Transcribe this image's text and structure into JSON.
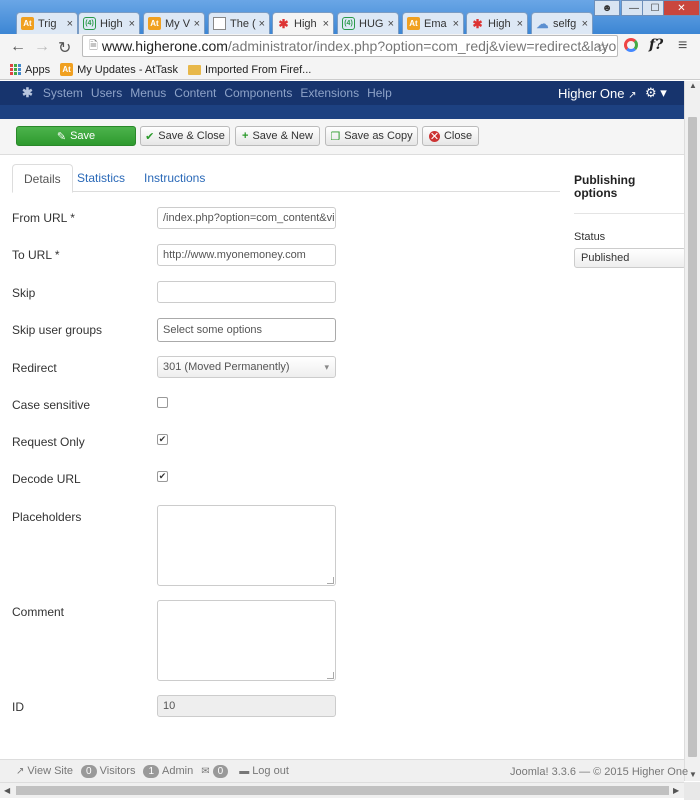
{
  "browser": {
    "tabs": [
      {
        "icon": "at-icon",
        "label": "Trig"
      },
      {
        "icon": "count-icon",
        "label": "High"
      },
      {
        "icon": "at-icon",
        "label": "My V"
      },
      {
        "icon": "doc-icon",
        "label": "The ("
      },
      {
        "icon": "joomla-icon",
        "label": "High"
      },
      {
        "icon": "count-icon",
        "label": "HUG"
      },
      {
        "icon": "at-icon",
        "label": "Ema"
      },
      {
        "icon": "joomla-icon",
        "label": "High"
      },
      {
        "icon": "cloud-icon",
        "label": "selfg"
      }
    ],
    "fav_at": "At",
    "fav_count": "(4)",
    "close_glyph": "×",
    "url_host": "www.higherone.com",
    "url_path": "/administrator/index.php?option=com_redj&view=redirect&layout=",
    "ext_f": "f?",
    "bookmarks": [
      {
        "icon": "apps-icon",
        "label": "Apps"
      },
      {
        "icon": "at-icon",
        "label": "My Updates - AtTask"
      },
      {
        "icon": "folder-icon",
        "label": "Imported From Firef..."
      }
    ]
  },
  "admin_nav": {
    "items": [
      "System",
      "Users",
      "Menus",
      "Content",
      "Components",
      "Extensions",
      "Help"
    ],
    "site_name": "Higher One"
  },
  "toolbar": {
    "save": "Save",
    "save_close": "Save & Close",
    "save_new": "Save & New",
    "save_copy": "Save as Copy",
    "close": "Close"
  },
  "form_tabs": [
    "Details",
    "Statistics",
    "Instructions"
  ],
  "form": {
    "from_url_label": "From URL *",
    "from_url_value": "/index.php?option=com_content&vie",
    "to_url_label": "To URL *",
    "to_url_value": "http://www.myonemoney.com",
    "skip_label": "Skip",
    "skip_value": "",
    "skip_groups_label": "Skip user groups",
    "skip_groups_placeholder": "Select some options",
    "redirect_label": "Redirect",
    "redirect_value": "301 (Moved Permanently)",
    "case_sensitive_label": "Case sensitive",
    "case_sensitive_checked": false,
    "request_only_label": "Request Only",
    "request_only_checked": true,
    "decode_url_label": "Decode URL",
    "decode_url_checked": true,
    "placeholders_label": "Placeholders",
    "comment_label": "Comment",
    "id_label": "ID",
    "id_value": "10"
  },
  "sidebar": {
    "title": "Publishing options",
    "status_label": "Status",
    "status_value": "Published"
  },
  "footer": {
    "view_site": "View Site",
    "visitors_count": "0",
    "visitors": "Visitors",
    "admin_count": "1",
    "admin": "Admin",
    "messages_count": "0",
    "logout": "Log out",
    "copyright": "Joomla! 3.3.6  —  © 2015 Higher One"
  },
  "colors": {
    "admin_nav": "#17346d",
    "save_green": "#3aa53a",
    "link_blue": "#2a69b8",
    "close_red": "#cc3333"
  }
}
